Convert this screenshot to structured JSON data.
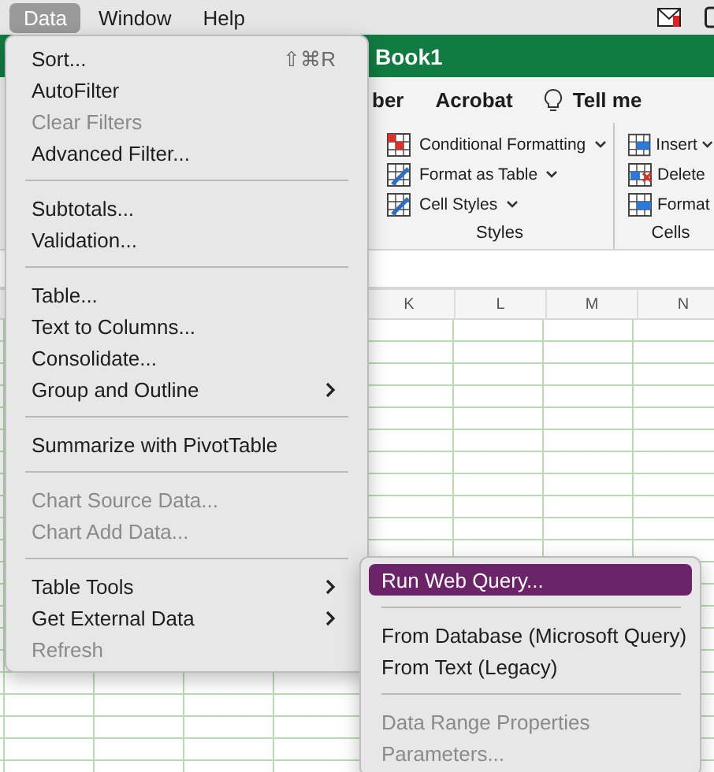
{
  "menubar": {
    "items": [
      {
        "label": "Data",
        "selected": true
      },
      {
        "label": "Window",
        "selected": false
      },
      {
        "label": "Help",
        "selected": false
      }
    ]
  },
  "window": {
    "title": "Book1"
  },
  "ribbon_tabs": [
    {
      "label": "ber",
      "kind": "tab"
    },
    {
      "label": "Acrobat",
      "kind": "tab"
    },
    {
      "label": "Tell me",
      "kind": "search"
    }
  ],
  "ribbon_groups": [
    {
      "label": "Styles",
      "commands": [
        {
          "label": "Conditional Formatting",
          "dropdown": true
        },
        {
          "label": "Format as Table",
          "dropdown": true
        },
        {
          "label": "Cell Styles",
          "dropdown": true
        }
      ]
    },
    {
      "label": "Cells",
      "commands": [
        {
          "label": "Insert",
          "dropdown": true
        },
        {
          "label": "Delete",
          "dropdown": false
        },
        {
          "label": "Format",
          "dropdown": false
        }
      ]
    }
  ],
  "columns": [
    "K",
    "L",
    "M",
    "N"
  ],
  "data_menu": {
    "items": [
      {
        "kind": "item",
        "label": "Sort...",
        "shortcut": "⇧⌘R",
        "disabled": false,
        "submenu": false
      },
      {
        "kind": "item",
        "label": "AutoFilter",
        "disabled": false,
        "submenu": false
      },
      {
        "kind": "item",
        "label": "Clear Filters",
        "disabled": true,
        "submenu": false
      },
      {
        "kind": "item",
        "label": "Advanced Filter...",
        "disabled": false,
        "submenu": false
      },
      {
        "kind": "separator"
      },
      {
        "kind": "item",
        "label": "Subtotals...",
        "disabled": false,
        "submenu": false
      },
      {
        "kind": "item",
        "label": "Validation...",
        "disabled": false,
        "submenu": false
      },
      {
        "kind": "separator"
      },
      {
        "kind": "item",
        "label": "Table...",
        "disabled": false,
        "submenu": false
      },
      {
        "kind": "item",
        "label": "Text to Columns...",
        "disabled": false,
        "submenu": false
      },
      {
        "kind": "item",
        "label": "Consolidate...",
        "disabled": false,
        "submenu": false
      },
      {
        "kind": "item",
        "label": "Group and Outline",
        "disabled": false,
        "submenu": true
      },
      {
        "kind": "separator"
      },
      {
        "kind": "item",
        "label": "Summarize with PivotTable",
        "disabled": false,
        "submenu": false
      },
      {
        "kind": "separator"
      },
      {
        "kind": "item",
        "label": "Chart Source Data...",
        "disabled": true,
        "submenu": false
      },
      {
        "kind": "item",
        "label": "Chart Add Data...",
        "disabled": true,
        "submenu": false
      },
      {
        "kind": "separator"
      },
      {
        "kind": "item",
        "label": "Table Tools",
        "disabled": false,
        "submenu": true
      },
      {
        "kind": "item",
        "label": "Get External Data",
        "disabled": false,
        "submenu": true
      },
      {
        "kind": "item",
        "label": "Refresh",
        "disabled": true,
        "submenu": false
      }
    ]
  },
  "external_data_submenu": {
    "items": [
      {
        "kind": "item",
        "label": "Run Web Query...",
        "selected": true,
        "disabled": false
      },
      {
        "kind": "separator"
      },
      {
        "kind": "item",
        "label": "From Database (Microsoft Query)",
        "selected": false,
        "disabled": false
      },
      {
        "kind": "item",
        "label": "From Text (Legacy)",
        "selected": false,
        "disabled": false
      },
      {
        "kind": "separator"
      },
      {
        "kind": "item",
        "label": "Data Range Properties",
        "selected": false,
        "disabled": true
      },
      {
        "kind": "item",
        "label": "Parameters...",
        "selected": false,
        "disabled": true
      }
    ]
  }
}
